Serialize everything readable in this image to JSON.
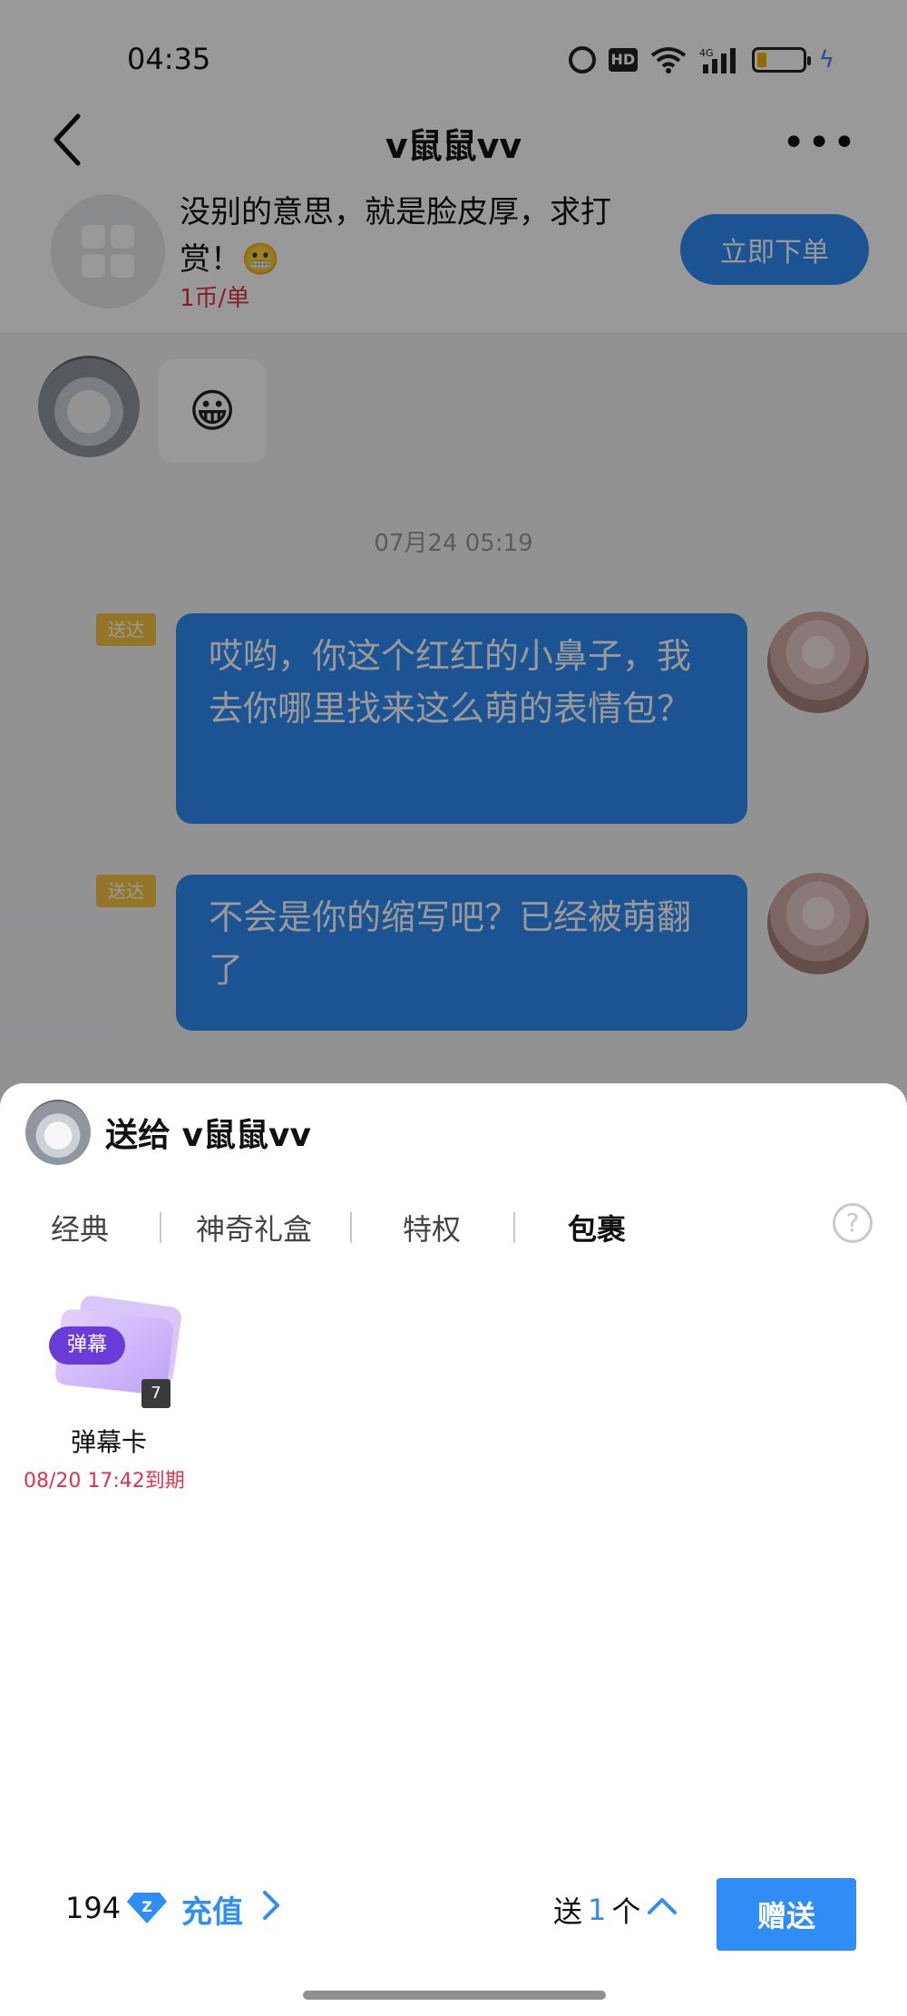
{
  "status_bar": {
    "time": "04:35",
    "hd_label": "HD",
    "network_label": "4G"
  },
  "header": {
    "title": "v鼠鼠vv"
  },
  "service_card": {
    "description": "没别的意思，就是脸皮厚，求打赏！😬",
    "price": "1币/单",
    "order_button": "立即下单"
  },
  "chat": {
    "received_emoji": "😀",
    "timestamp": "07月24 05:19",
    "messages": [
      {
        "tag": "送达",
        "text": "哎哟，你这个红红的小鼻子，我去你哪里找来这么萌的表情包？"
      },
      {
        "tag": "送达",
        "text": "不会是你的缩写吧？已经被萌翻了"
      }
    ]
  },
  "gift_sheet": {
    "recipient": "送给 v鼠鼠vv",
    "tabs": [
      "经典",
      "神奇礼盒",
      "特权",
      "包裹"
    ],
    "active_tab": "包裹",
    "help_icon": "?",
    "items": [
      {
        "card_tag": "弹幕",
        "count": "7",
        "name": "弹幕卡",
        "expire": "08/20 17:42到期"
      }
    ],
    "balance": "194",
    "recharge_label": "充值",
    "quantity_prefix": "送",
    "quantity": "1",
    "quantity_suffix": "个",
    "give_button": "赠送"
  },
  "colors": {
    "accent": "#2f8df5",
    "price_red": "#e0334a",
    "sent_tag": "#f5c542"
  }
}
